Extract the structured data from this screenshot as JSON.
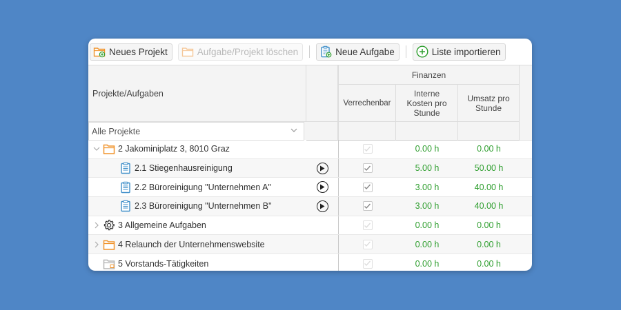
{
  "toolbar": {
    "new_project": "Neues Projekt",
    "delete": "Aufgabe/Projekt löschen",
    "new_task": "Neue Aufgabe",
    "import": "Liste importieren"
  },
  "header": {
    "projects_col": "Projekte/Aufgaben",
    "finance_group": "Finanzen",
    "billable": "Verrechenbar",
    "internal_cost_l1": "Interne",
    "internal_cost_l2": "Kosten pro",
    "internal_cost_l3": "Stunde",
    "revenue_l1": "Umsatz pro",
    "revenue_l2": "Stunde"
  },
  "filter": {
    "value": "Alle Projekte"
  },
  "rows": [
    {
      "name": "2 Jakominiplatz 3, 8010 Graz",
      "cost": "0.00 h",
      "revenue": "0.00 h"
    },
    {
      "name": "2.1 Stiegenhausreinigung",
      "cost": "5.00 h",
      "revenue": "50.00 h"
    },
    {
      "name": "2.2 Büroreinigung \"Unternehmen A\"",
      "cost": "3.00 h",
      "revenue": "40.00 h"
    },
    {
      "name": "2.3 Büroreinigung \"Unternehmen B\"",
      "cost": "3.00 h",
      "revenue": "40.00 h"
    },
    {
      "name": "3 Allgemeine Aufgaben",
      "cost": "0.00 h",
      "revenue": "0.00 h"
    },
    {
      "name": "4 Relaunch der Unternehmenswebsite",
      "cost": "0.00 h",
      "revenue": "0.00 h"
    },
    {
      "name": "5 Vorstands-Tätigkeiten",
      "cost": "0.00 h",
      "revenue": "0.00 h"
    }
  ],
  "colors": {
    "background": "#4f86c6",
    "value_green": "#2e9e2e",
    "folder_orange": "#f0932b"
  }
}
